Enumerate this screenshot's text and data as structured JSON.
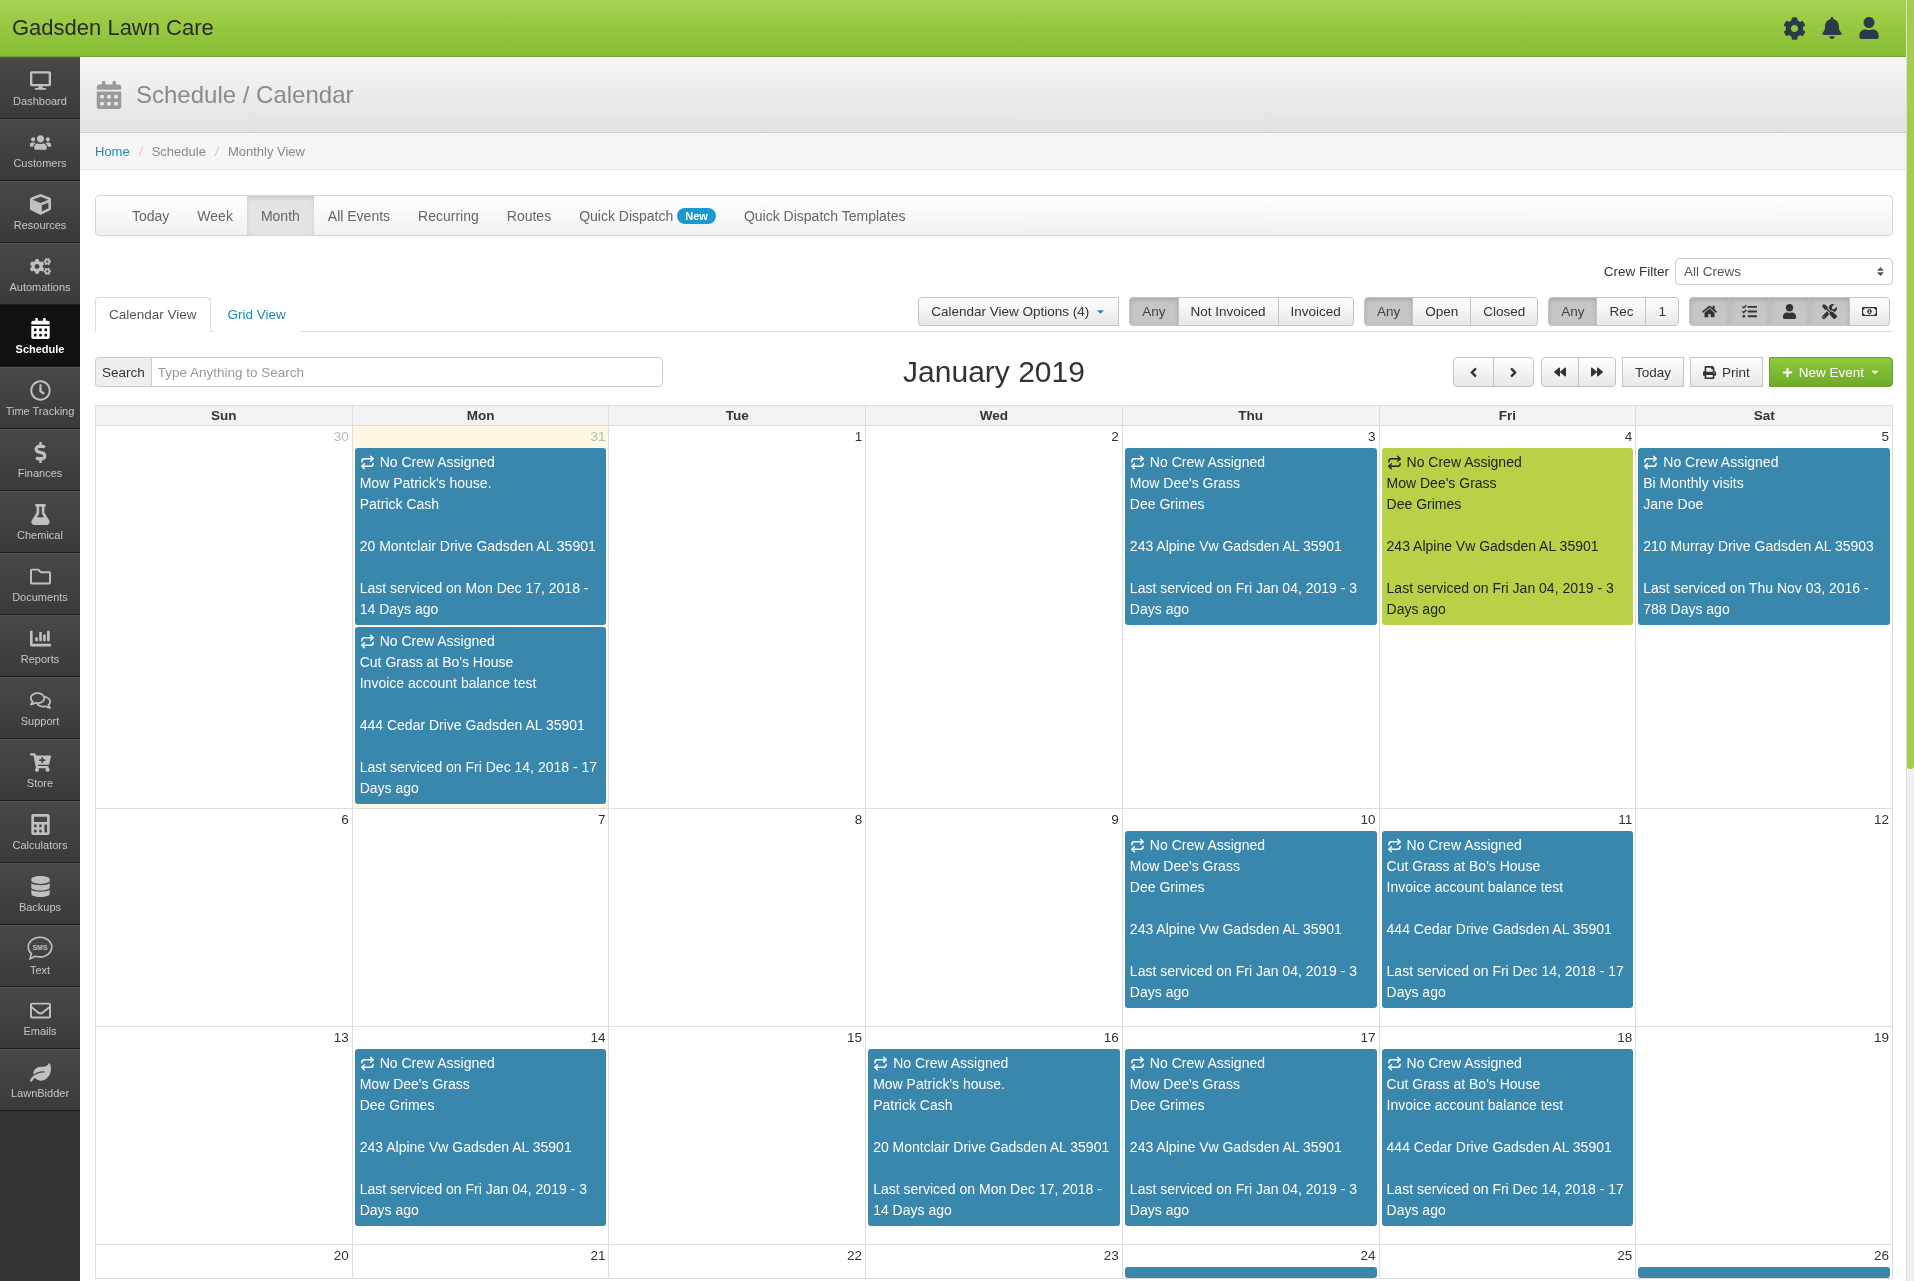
{
  "app": {
    "title": "Gadsden Lawn Care"
  },
  "sidebar": {
    "items": [
      {
        "label": "Dashboard",
        "selected": false
      },
      {
        "label": "Customers",
        "selected": false
      },
      {
        "label": "Resources",
        "selected": false
      },
      {
        "label": "Automations",
        "selected": false
      },
      {
        "label": "Schedule",
        "selected": true
      },
      {
        "label": "Time Tracking",
        "selected": false
      },
      {
        "label": "Finances",
        "selected": false
      },
      {
        "label": "Chemical",
        "selected": false
      },
      {
        "label": "Documents",
        "selected": false
      },
      {
        "label": "Reports",
        "selected": false
      },
      {
        "label": "Support",
        "selected": false
      },
      {
        "label": "Store",
        "selected": false
      },
      {
        "label": "Calculators",
        "selected": false
      },
      {
        "label": "Backups",
        "selected": false
      },
      {
        "label": "Text",
        "selected": false,
        "icon_label": "SMS"
      },
      {
        "label": "Emails",
        "selected": false
      },
      {
        "label": "LawnBidder",
        "selected": false
      }
    ]
  },
  "page_header": {
    "title": "Schedule / Calendar"
  },
  "breadcrumb": [
    {
      "label": "Home",
      "kind": "link"
    },
    {
      "label": "Schedule",
      "kind": "text"
    },
    {
      "label": "Monthly View",
      "kind": "text"
    }
  ],
  "view_tabs": [
    {
      "label": "Today",
      "selected": false
    },
    {
      "label": "Week",
      "selected": false
    },
    {
      "label": "Month",
      "selected": true
    },
    {
      "label": "All Events",
      "selected": false
    },
    {
      "label": "Recurring",
      "selected": false
    },
    {
      "label": "Routes",
      "selected": false
    },
    {
      "label": "Quick Dispatch",
      "selected": false,
      "badge": "New"
    },
    {
      "label": "Quick Dispatch Templates",
      "selected": false
    }
  ],
  "crew_filter": {
    "label": "Crew Filter",
    "value": "All Crews"
  },
  "display_tabs": [
    {
      "label": "Calendar View",
      "selected": true
    },
    {
      "label": "Grid View",
      "selected": false
    }
  ],
  "options_button": {
    "label": "Calendar View Options (4)"
  },
  "filter_groups": [
    {
      "buttons": [
        {
          "label": "Any",
          "selected": true
        },
        {
          "label": "Not Invoiced",
          "selected": false
        },
        {
          "label": "Invoiced",
          "selected": false
        }
      ]
    },
    {
      "buttons": [
        {
          "label": "Any",
          "selected": true
        },
        {
          "label": "Open",
          "selected": false
        },
        {
          "label": "Closed",
          "selected": false
        }
      ]
    },
    {
      "buttons": [
        {
          "label": "Any",
          "selected": true
        },
        {
          "label": "Rec",
          "selected": false
        },
        {
          "label": "1",
          "selected": false
        }
      ]
    }
  ],
  "icon_filters": [
    {
      "selected": true
    },
    {
      "selected": true
    },
    {
      "selected": true
    },
    {
      "selected": true
    },
    {
      "selected": false
    }
  ],
  "search": {
    "label": "Search",
    "placeholder": "Type Anything to Search"
  },
  "calendar": {
    "title": "January 2019",
    "today_button": "Today",
    "print_button": "Print",
    "new_event_button": "New Event",
    "weekdays": [
      "Sun",
      "Mon",
      "Tue",
      "Wed",
      "Thu",
      "Fri",
      "Sat"
    ],
    "weeks": [
      {
        "days": [
          {
            "date": "30",
            "other_month": true,
            "today": false
          },
          {
            "date": "31",
            "other_month": true,
            "today": true,
            "events": [
              {
                "color": "#3a87ad",
                "crew": "No Crew Assigned",
                "title": "Mow Patrick's house.",
                "customer": "Patrick Cash",
                "address": "20 Montclair Drive Gadsden AL 35901",
                "last_serviced": "Last serviced on Mon Dec 17, 2018 - 14 Days ago"
              },
              {
                "color": "#3a87ad",
                "crew": "No Crew Assigned",
                "title": "Cut Grass at Bo's House",
                "customer": "Invoice account balance test",
                "address": "444 Cedar Drive Gadsden AL 35901",
                "last_serviced": "Last serviced on Fri Dec 14, 2018 - 17 Days ago"
              }
            ]
          },
          {
            "date": "1",
            "other_month": false,
            "today": false
          },
          {
            "date": "2",
            "other_month": false,
            "today": false
          },
          {
            "date": "3",
            "other_month": false,
            "today": false,
            "events": [
              {
                "color": "#3a87ad",
                "crew": "No Crew Assigned",
                "title": "Mow Dee's Grass",
                "customer": "Dee Grimes",
                "address": "243 Alpine Vw Gadsden AL 35901",
                "last_serviced": "Last serviced on Fri Jan 04, 2019 - 3 Days ago"
              }
            ]
          },
          {
            "date": "4",
            "other_month": false,
            "today": false,
            "events": [
              {
                "color": "#b9d147",
                "crew": "No Crew Assigned",
                "title": "Mow Dee's Grass",
                "customer": "Dee Grimes",
                "address": "243 Alpine Vw Gadsden AL 35901",
                "last_serviced": "Last serviced on Fri Jan 04, 2019 - 3 Days ago"
              }
            ]
          },
          {
            "date": "5",
            "other_month": false,
            "today": false,
            "events": [
              {
                "color": "#3a87ad",
                "crew": "No Crew Assigned",
                "title": "Bi Monthly visits",
                "customer": "Jane Doe",
                "address": "210 Murray Drive Gadsden AL 35903",
                "last_serviced": "Last serviced on Thu Nov 03, 2016 - 788 Days ago"
              }
            ]
          }
        ]
      },
      {
        "days": [
          {
            "date": "6",
            "other_month": false,
            "today": false
          },
          {
            "date": "7",
            "other_month": false,
            "today": false
          },
          {
            "date": "8",
            "other_month": false,
            "today": false
          },
          {
            "date": "9",
            "other_month": false,
            "today": false
          },
          {
            "date": "10",
            "other_month": false,
            "today": false,
            "events": [
              {
                "color": "#3a87ad",
                "crew": "No Crew Assigned",
                "title": "Mow Dee's Grass",
                "customer": "Dee Grimes",
                "address": "243 Alpine Vw Gadsden AL 35901",
                "last_serviced": "Last serviced on Fri Jan 04, 2019 - 3 Days ago"
              }
            ]
          },
          {
            "date": "11",
            "other_month": false,
            "today": false,
            "events": [
              {
                "color": "#3a87ad",
                "crew": "No Crew Assigned",
                "title": "Cut Grass at Bo's House",
                "customer": "Invoice account balance test",
                "address": "444 Cedar Drive Gadsden AL 35901",
                "last_serviced": "Last serviced on Fri Dec 14, 2018 - 17 Days ago"
              }
            ]
          },
          {
            "date": "12",
            "other_month": false,
            "today": false
          }
        ]
      },
      {
        "days": [
          {
            "date": "13",
            "other_month": false,
            "today": false
          },
          {
            "date": "14",
            "other_month": false,
            "today": false,
            "events": [
              {
                "color": "#3a87ad",
                "crew": "No Crew Assigned",
                "title": "Mow Dee's Grass",
                "customer": "Dee Grimes",
                "address": "243 Alpine Vw Gadsden AL 35901",
                "last_serviced": "Last serviced on Fri Jan 04, 2019 - 3 Days ago"
              }
            ]
          },
          {
            "date": "15",
            "other_month": false,
            "today": false
          },
          {
            "date": "16",
            "other_month": false,
            "today": false,
            "events": [
              {
                "color": "#3a87ad",
                "crew": "No Crew Assigned",
                "title": "Mow Patrick's house.",
                "customer": "Patrick Cash",
                "address": "20 Montclair Drive Gadsden AL 35901",
                "last_serviced": "Last serviced on Mon Dec 17, 2018 - 14 Days ago"
              }
            ]
          },
          {
            "date": "17",
            "other_month": false,
            "today": false,
            "events": [
              {
                "color": "#3a87ad",
                "crew": "No Crew Assigned",
                "title": "Mow Dee's Grass",
                "customer": "Dee Grimes",
                "address": "243 Alpine Vw Gadsden AL 35901",
                "last_serviced": "Last serviced on Fri Jan 04, 2019 - 3 Days ago"
              }
            ]
          },
          {
            "date": "18",
            "other_month": false,
            "today": false,
            "events": [
              {
                "color": "#3a87ad",
                "crew": "No Crew Assigned",
                "title": "Cut Grass at Bo's House",
                "customer": "Invoice account balance test",
                "address": "444 Cedar Drive Gadsden AL 35901",
                "last_serviced": "Last serviced on Fri Dec 14, 2018 - 17 Days ago"
              }
            ]
          },
          {
            "date": "19",
            "other_month": false,
            "today": false
          }
        ]
      },
      {
        "days": [
          {
            "date": "20",
            "other_month": false,
            "today": false
          },
          {
            "date": "21",
            "other_month": false,
            "today": false
          },
          {
            "date": "22",
            "other_month": false,
            "today": false
          },
          {
            "date": "23",
            "other_month": false,
            "today": false
          },
          {
            "date": "24",
            "other_month": false,
            "today": false,
            "events": [
              {
                "color": "#3a87ad"
              }
            ]
          },
          {
            "date": "25",
            "other_month": false,
            "today": false
          },
          {
            "date": "26",
            "other_month": false,
            "today": false,
            "events": [
              {
                "color": "#3a87ad"
              }
            ]
          }
        ]
      }
    ]
  }
}
